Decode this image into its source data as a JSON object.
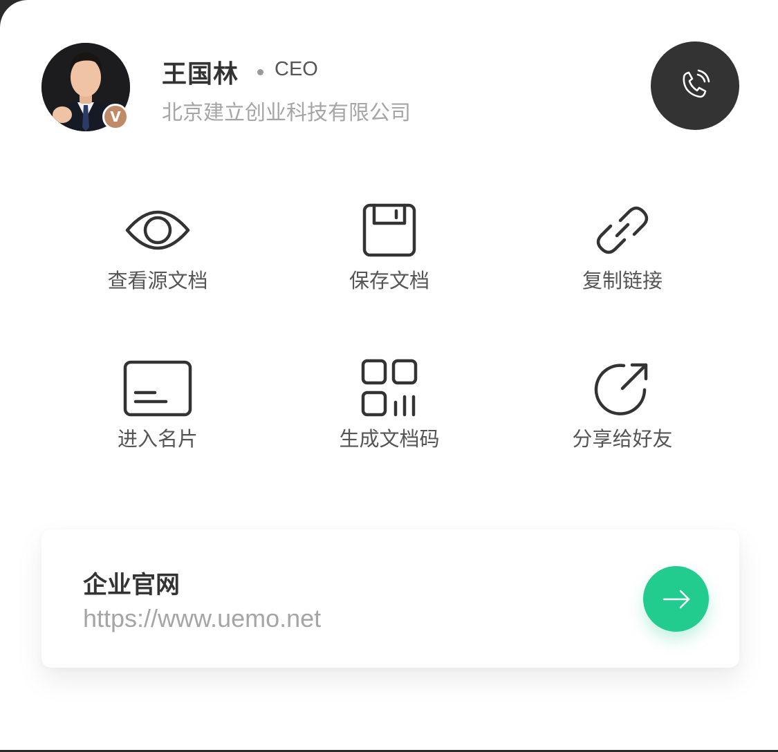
{
  "profile": {
    "name": "王国林",
    "role": "CEO",
    "company": "北京建立创业科技有限公司",
    "verified_badge": "V",
    "avatar_icon": "person-avatar"
  },
  "actions": [
    {
      "label": "查看源文档",
      "icon": "eye-icon"
    },
    {
      "label": "保存文档",
      "icon": "floppy-disk-icon"
    },
    {
      "label": "复制链接",
      "icon": "link-icon"
    },
    {
      "label": "进入名片",
      "icon": "card-icon"
    },
    {
      "label": "生成文档码",
      "icon": "qr-code-icon"
    },
    {
      "label": "分享给好友",
      "icon": "share-icon"
    }
  ],
  "website": {
    "title": "企业官网",
    "url": "https://www.uemo.net"
  },
  "colors": {
    "dark": "#333333",
    "accent_green": "#21cc8e",
    "badge_bronze": "#c08a67",
    "muted_text": "#a5a5a5"
  }
}
